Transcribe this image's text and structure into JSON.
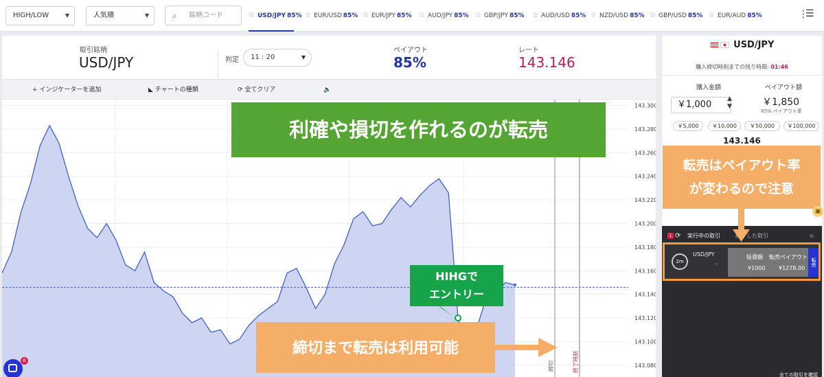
{
  "topbar": {
    "type_select": "HIGH/LOW",
    "sort_select": "人気順",
    "search_placeholder": "銘柄コード",
    "tabs": [
      {
        "symbol": "USD/JPY",
        "payout": "85%"
      },
      {
        "symbol": "EUR/USD",
        "payout": "85%"
      },
      {
        "symbol": "EUR/JPY",
        "payout": "85%"
      },
      {
        "symbol": "AUD/JPY",
        "payout": "85%"
      },
      {
        "symbol": "GBP/JPY",
        "payout": "85%"
      },
      {
        "symbol": "AUD/USD",
        "payout": "85%"
      },
      {
        "symbol": "NZD/USD",
        "payout": "85%"
      },
      {
        "symbol": "GBP/USD",
        "payout": "85%"
      },
      {
        "symbol": "EUR/AUD",
        "payout": "85%"
      }
    ]
  },
  "info": {
    "symbol_label": "取引銘柄",
    "symbol": "USD/JPY",
    "judge_label": "判定",
    "judge_time": "11 : 20",
    "payout_label": "ペイアウト",
    "payout": "85%",
    "rate_label": "レート",
    "rate": "143.146"
  },
  "toolbar": {
    "indicator": "インジケーターを追加",
    "chart_type": "チャートの種類",
    "clear_all": "全てクリア"
  },
  "chart_data": {
    "type": "area",
    "y_ticks": [
      "143.300",
      "143.280",
      "143.260",
      "143.240",
      "143.220",
      "143.200",
      "143.180",
      "143.160",
      "143.140",
      "143.120",
      "143.100",
      "143.080"
    ],
    "ylim": [
      143.07,
      143.305
    ],
    "current_rate": 143.146,
    "vline_labels": [
      "締切",
      "終了時刻"
    ],
    "values": [
      143.158,
      143.176,
      143.21,
      143.234,
      143.266,
      143.283,
      143.268,
      143.24,
      143.215,
      143.196,
      143.188,
      143.2,
      143.186,
      143.165,
      143.16,
      143.176,
      143.15,
      143.143,
      143.138,
      143.124,
      143.116,
      143.12,
      143.108,
      143.11,
      143.098,
      143.102,
      143.114,
      143.122,
      143.128,
      143.134,
      143.158,
      143.162,
      143.146,
      143.128,
      143.14,
      143.166,
      143.182,
      143.204,
      143.21,
      143.198,
      143.2,
      143.212,
      143.222,
      143.214,
      143.224,
      143.232,
      143.238,
      143.226,
      143.12,
      143.098,
      143.112,
      143.138,
      143.142,
      143.15,
      143.148
    ]
  },
  "annotations": {
    "main_callout": "利確や損切を作れるのが転売",
    "entry_callout_1": "HIHGで",
    "entry_callout_2": "エントリー",
    "bottom_callout": "締切まで転売は利用可能",
    "right_callout_1": "転売はペイアウト率",
    "right_callout_2": "が変わるので注意"
  },
  "order": {
    "symbol": "USD/JPY",
    "remaining_label": "購入締切時刻までの残り時間:",
    "remaining_time": "01:46",
    "amount_label": "購入金額",
    "amount": "￥1,000",
    "payout_label": "ペイアウト額",
    "payout_amount": "￥1,850",
    "payout_rate": "85% ペイアウト率",
    "quick": [
      "￥5,000",
      "￥10,000",
      "￥50,000",
      "￥100,000"
    ],
    "rate": "143.146"
  },
  "trades": {
    "badge": "1",
    "active_tab": "実行中の取引",
    "ended_tab": "終了した取引",
    "timer": "2m",
    "symbol": "USD/JPY",
    "invest_label": "投資額",
    "resale_label": "転売ペイアウト",
    "invest": "¥1000",
    "resale": "¥1278.00",
    "resale_btn": "転売",
    "footer": "全ての取引を確認"
  },
  "chat": {
    "badge": "6"
  }
}
